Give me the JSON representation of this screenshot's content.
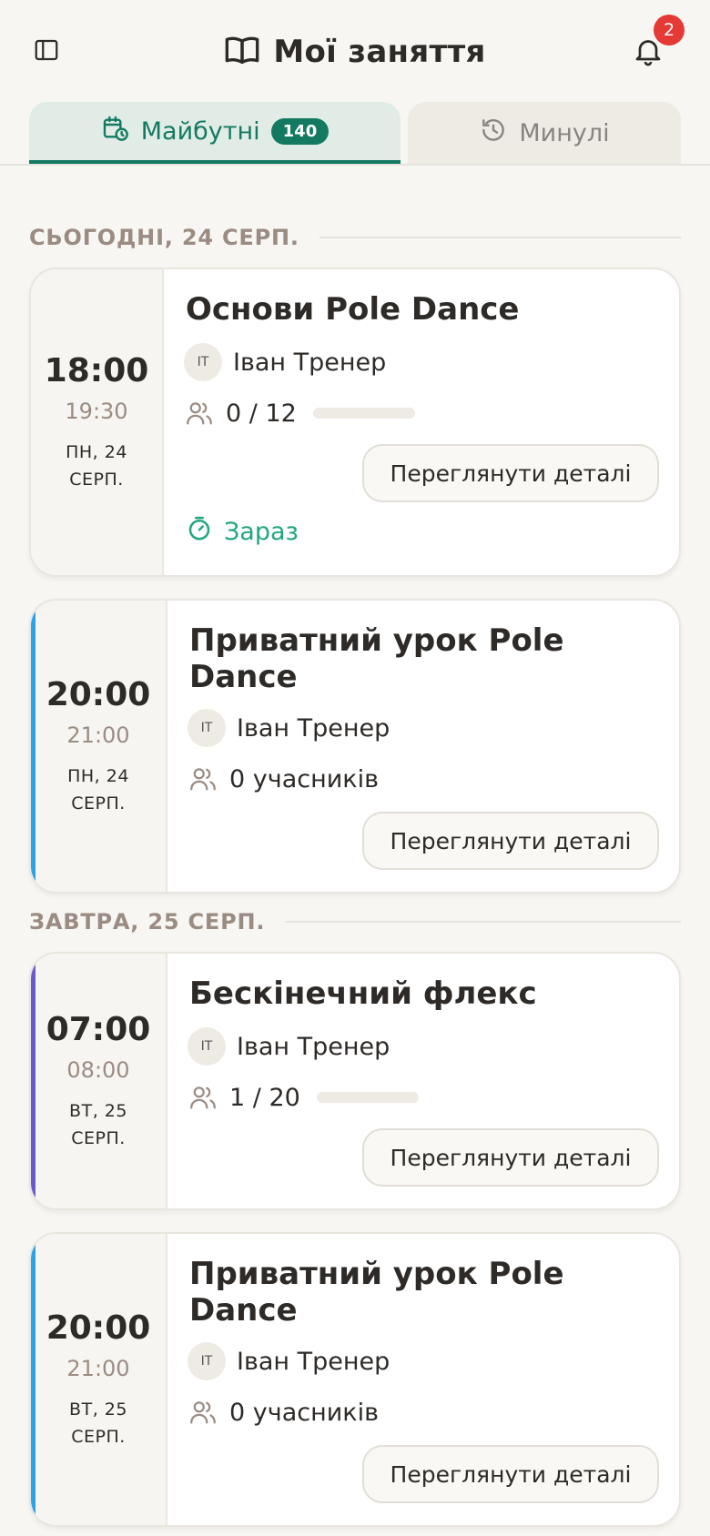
{
  "header": {
    "title": "Мої заняття",
    "notifications_count": "2",
    "icons": {
      "sidebar": "sidebar-toggle-icon",
      "book": "book-open-icon",
      "bell": "bell-icon"
    }
  },
  "tabs": {
    "upcoming": {
      "label": "Майбутні",
      "count": "140",
      "icon": "calendar-clock-icon"
    },
    "past": {
      "label": "Минулі",
      "icon": "history-icon"
    }
  },
  "sections": [
    {
      "label": "СЬОГОДНІ, 24 СЕРП."
    },
    {
      "label": "ЗАВТРА, 25 СЕРП."
    }
  ],
  "classes": [
    {
      "title": "Основи Pole Dance",
      "time_start": "18:00",
      "time_end": "19:30",
      "date_line1": "ПН, 24",
      "date_line2": "СЕРП.",
      "trainer_initials": "IT",
      "trainer": "Іван Тренер",
      "participants": "0 / 12",
      "fill_fraction": 0,
      "details_label": "Переглянути деталі",
      "status": "Зараз",
      "accent_color": ""
    },
    {
      "title": "Приватний урок Pole Dance",
      "time_start": "20:00",
      "time_end": "21:00",
      "date_line1": "ПН, 24",
      "date_line2": "СЕРП.",
      "trainer_initials": "IT",
      "trainer": "Іван Тренер",
      "participants": "0 учасників",
      "details_label": "Переглянути деталі",
      "accent_color": "#2ba3e8"
    },
    {
      "title": "Бескінечний флекс",
      "time_start": "07:00",
      "time_end": "08:00",
      "date_line1": "ВТ, 25",
      "date_line2": "СЕРП.",
      "trainer_initials": "IT",
      "trainer": "Іван Тренер",
      "participants": "1 / 20",
      "fill_fraction": 0.05,
      "details_label": "Переглянути деталі",
      "accent_color": "#6a5acd"
    },
    {
      "title": "Приватний урок Pole Dance",
      "time_start": "20:00",
      "time_end": "21:00",
      "date_line1": "ВТ, 25",
      "date_line2": "СЕРП.",
      "trainer_initials": "IT",
      "trainer": "Іван Тренер",
      "participants": "0 учасників",
      "details_label": "Переглянути деталі",
      "accent_color": "#2ba3e8"
    }
  ],
  "colors": {
    "primary": "#137a61",
    "now_status": "#22a67e",
    "badge": "#e53935"
  }
}
